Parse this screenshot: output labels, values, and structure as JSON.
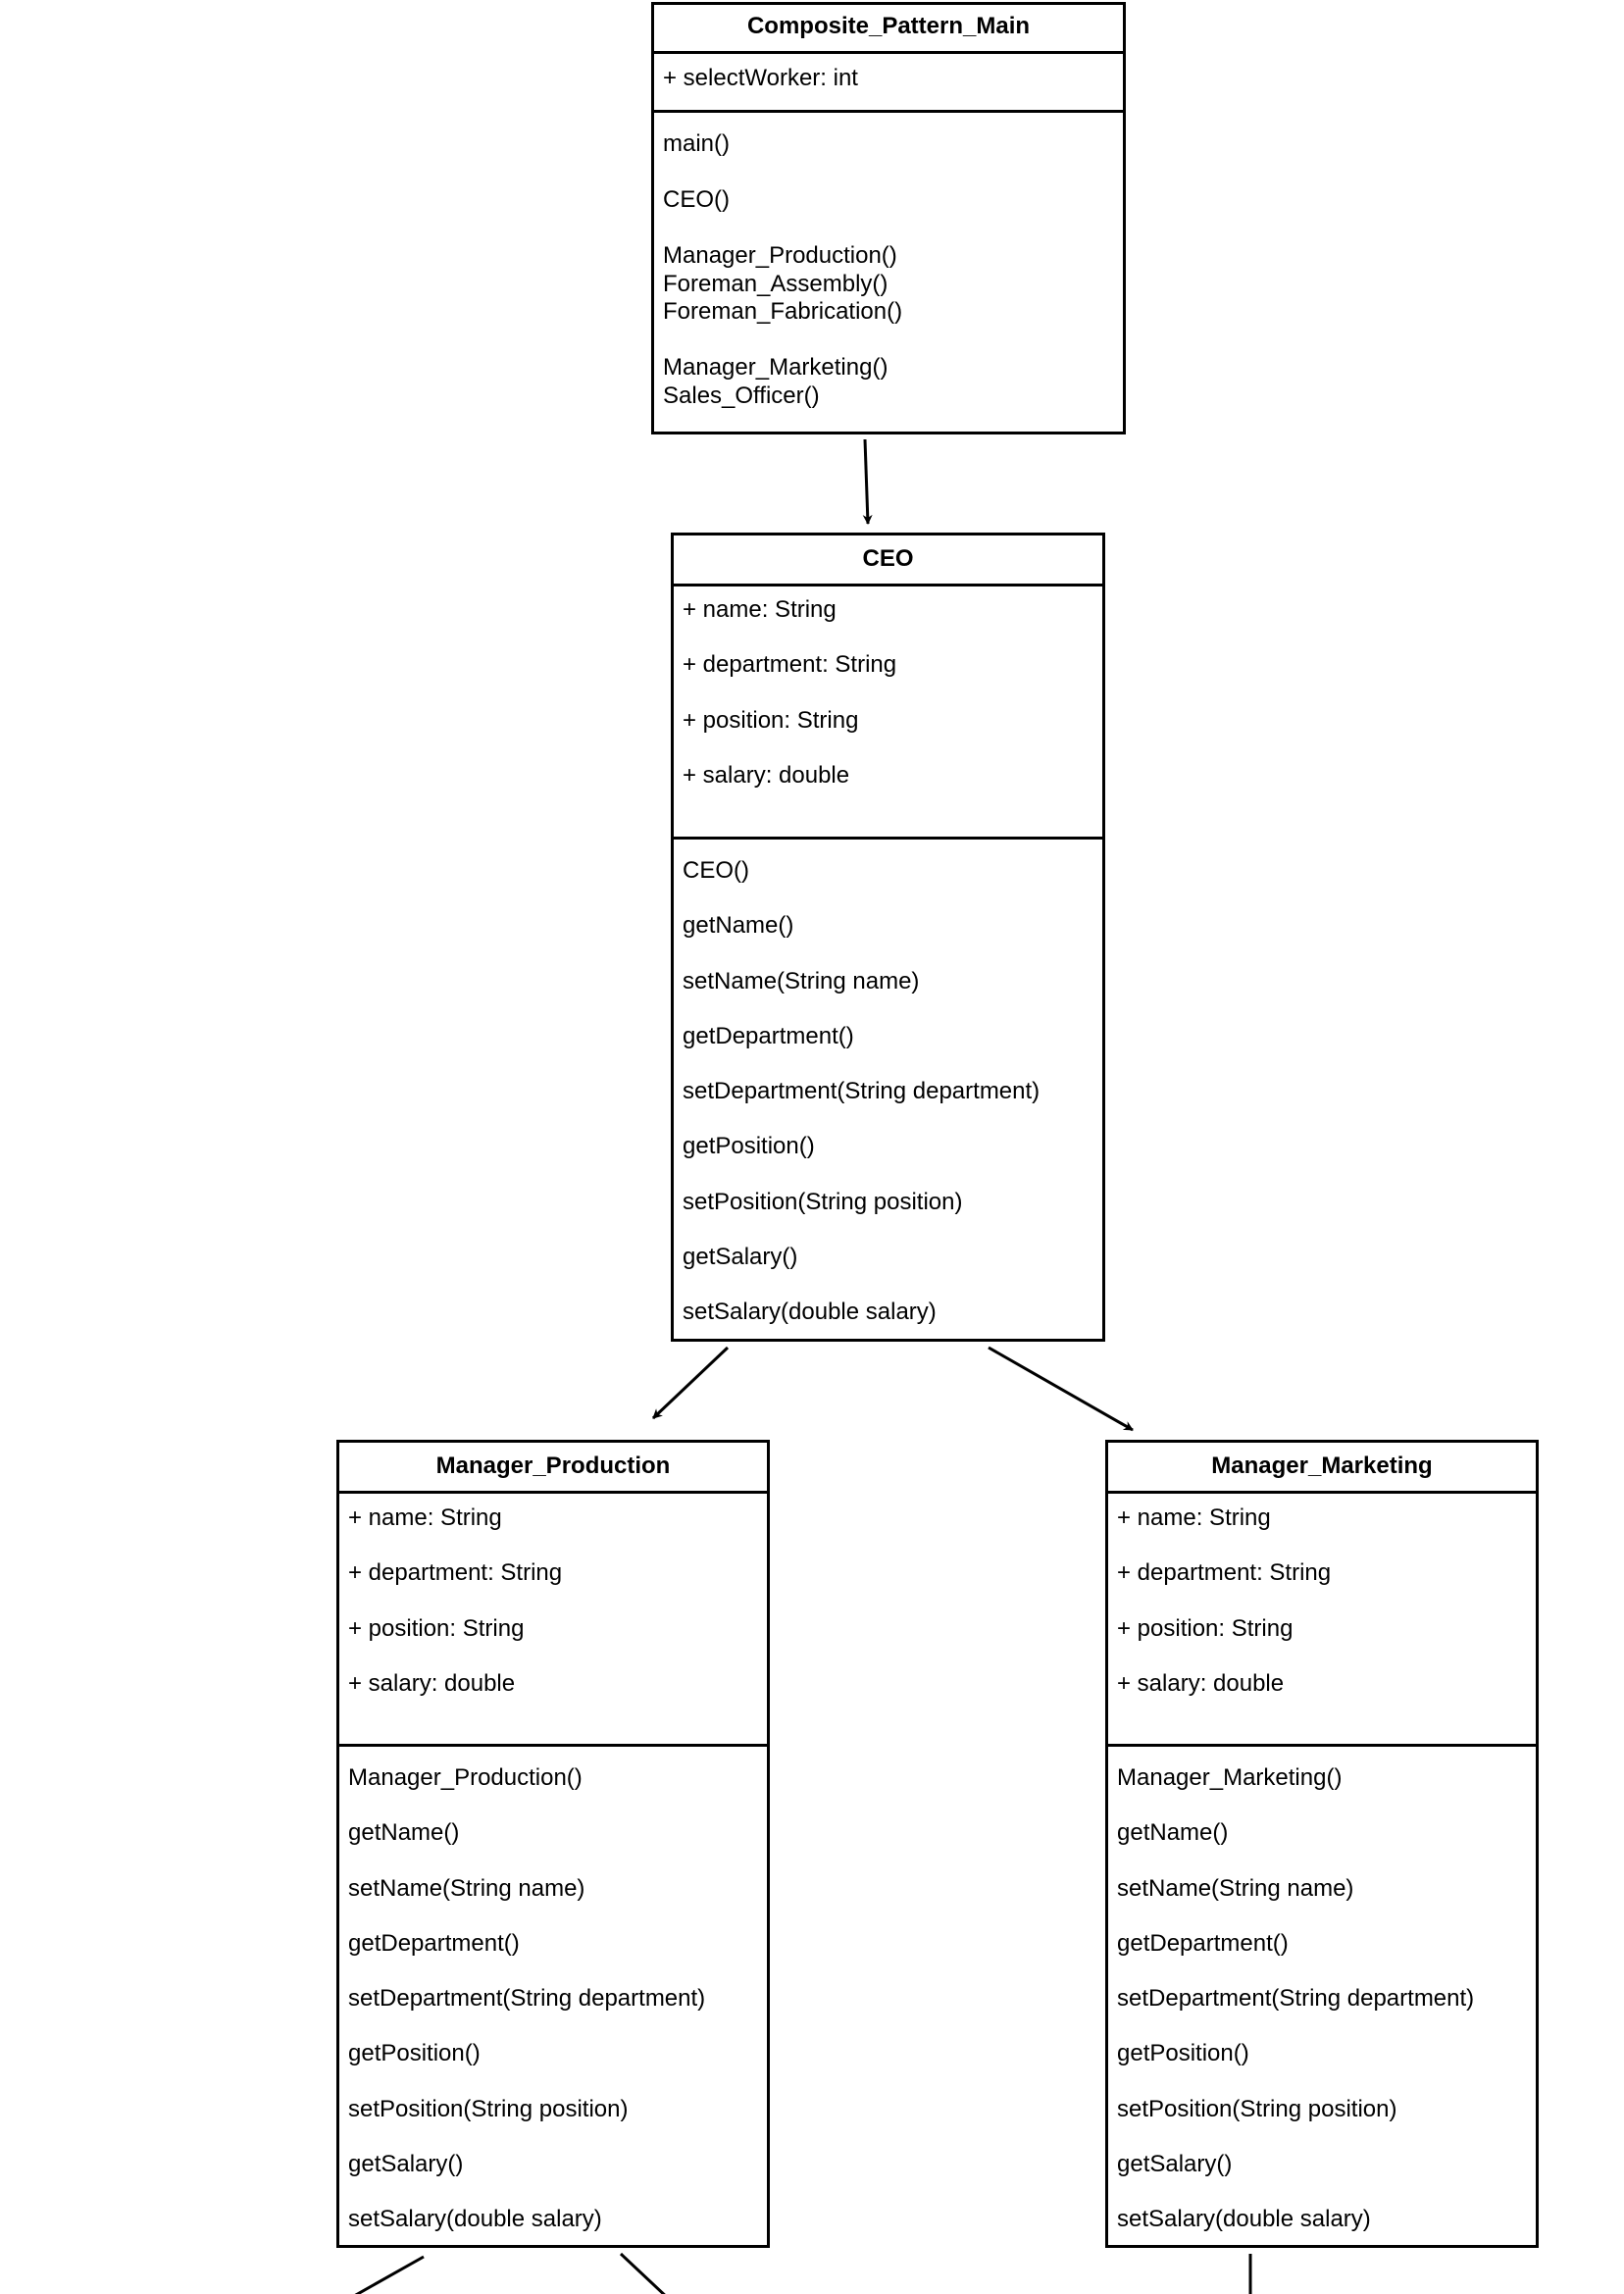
{
  "classes": [
    {
      "id": "composite-pattern-main",
      "title": "Composite_Pattern_Main",
      "attributes": [
        "+ selectWorker: int"
      ],
      "method_groups": [
        [
          "main()"
        ],
        [
          "CEO()"
        ],
        [
          "Manager_Production()",
          "Foreman_Assembly()",
          "Foreman_Fabrication()"
        ],
        [
          "Manager_Marketing()",
          "Sales_Officer()"
        ]
      ]
    },
    {
      "id": "ceo",
      "title": "CEO",
      "attributes": [
        "+ name: String",
        "+ department: String",
        "+ position: String",
        "+ salary: double"
      ],
      "methods": [
        "CEO()",
        "getName()",
        "setName(String name)",
        "getDepartment()",
        "setDepartment(String department)",
        "getPosition()",
        "setPosition(String position)",
        "getSalary()",
        "setSalary(double salary)"
      ]
    },
    {
      "id": "manager-production",
      "title": "Manager_Production",
      "attributes": [
        "+ name: String",
        "+ department: String",
        "+ position: String",
        "+ salary: double"
      ],
      "methods": [
        "Manager_Production()",
        "getName()",
        "setName(String name)",
        "getDepartment()",
        "setDepartment(String department)",
        "getPosition()",
        "setPosition(String position)",
        "getSalary()",
        "setSalary(double salary)"
      ]
    },
    {
      "id": "manager-marketing",
      "title": "Manager_Marketing",
      "attributes": [
        "+ name: String",
        "+ department: String",
        "+ position: String",
        "+ salary: double"
      ],
      "methods": [
        "Manager_Marketing()",
        "getName()",
        "setName(String name)",
        "getDepartment()",
        "setDepartment(String department)",
        "getPosition()",
        "setPosition(String position)",
        "getSalary()",
        "setSalary(double salary)"
      ]
    }
  ],
  "relations": [
    {
      "from": "Composite_Pattern_Main",
      "to": "CEO",
      "type": "directed-association"
    },
    {
      "from": "CEO",
      "to": "Manager_Production",
      "type": "directed-association"
    },
    {
      "from": "CEO",
      "to": "Manager_Marketing",
      "type": "directed-association"
    }
  ],
  "colors": {
    "line": "#000000",
    "background": "#ffffff"
  }
}
